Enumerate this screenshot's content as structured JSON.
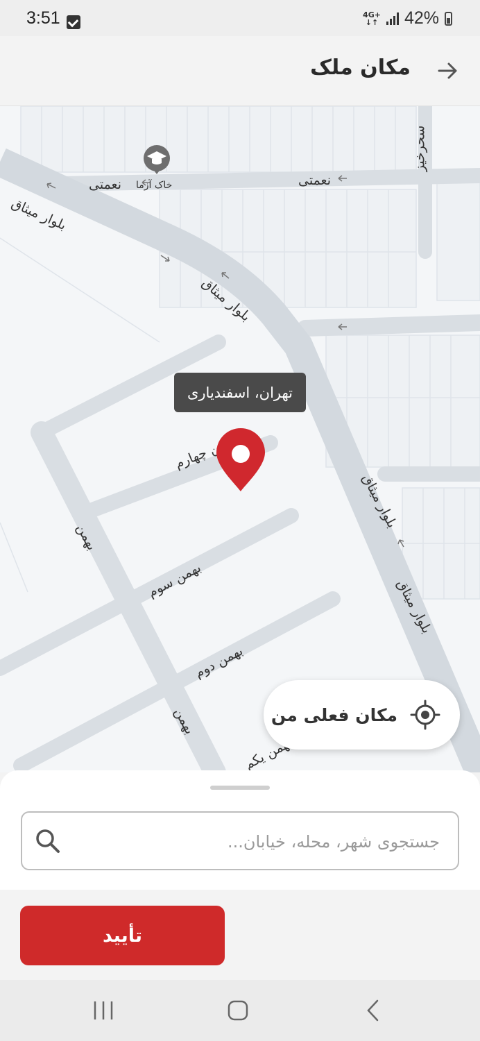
{
  "status_bar": {
    "time": "3:51",
    "network_top": "4G+",
    "network_bottom": "↓↑",
    "battery": "42%"
  },
  "header": {
    "title": "مکان ملک"
  },
  "map": {
    "streets": [
      {
        "id": "sahar-khiz",
        "text": "سحرخیز"
      },
      {
        "id": "nemati-1",
        "text": "نعمتی"
      },
      {
        "id": "nemati-2",
        "text": "نعمتی"
      },
      {
        "id": "khak-azma",
        "text": "خاک آزما"
      },
      {
        "id": "mithaq-1",
        "text": "بلوار میثاق"
      },
      {
        "id": "mithaq-2",
        "text": "بلوار میثاق"
      },
      {
        "id": "mithaq-3",
        "text": "بلوار میثاق"
      },
      {
        "id": "mithaq-4",
        "text": "بلوار میثاق"
      },
      {
        "id": "bahman-charom",
        "text": "بهمن چهارم"
      },
      {
        "id": "bahman-1",
        "text": "بهمن"
      },
      {
        "id": "bahman-2",
        "text": "بهمن"
      },
      {
        "id": "bahman-sevom",
        "text": "بهمن سوم"
      },
      {
        "id": "bahman-dovom",
        "text": "بهمن دوم"
      },
      {
        "id": "bahman-yekom",
        "text": "بهمن یکم"
      }
    ],
    "pin_label": "تهران، اسفندیاری",
    "pin_color": "#d0282e"
  },
  "my_location": {
    "label": "مکان فعلی من"
  },
  "search": {
    "placeholder": "جستجوی شهر، محله، خیابان..."
  },
  "confirm": {
    "label": "تأیید",
    "color": "#cf2a2a"
  }
}
